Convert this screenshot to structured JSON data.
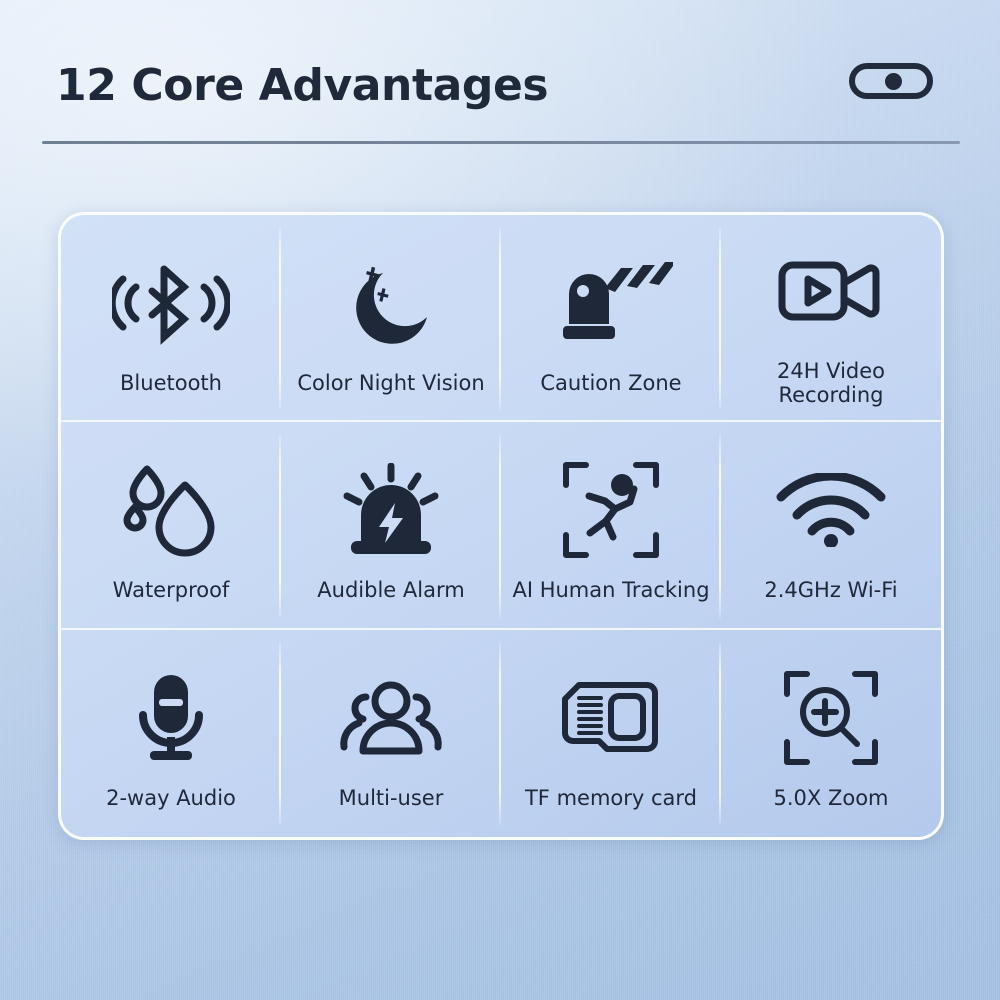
{
  "header": {
    "title": "12 Core Advantages",
    "toggle_name": "toggle-switch",
    "toggle_state": "on"
  },
  "colors": {
    "ink": "#20293a",
    "background_top": "#dde9f7",
    "background_bottom": "#a2bee2",
    "card_fill": "#cddcf4",
    "divider": "#ffffff",
    "rule": "#5b6a80"
  },
  "card": {
    "columns": 4,
    "rows": 3,
    "features": [
      {
        "label": "Bluetooth",
        "icon": "bluetooth-icon"
      },
      {
        "label": "Color Night Vision",
        "icon": "crescent-moon-stars-icon"
      },
      {
        "label": "Caution Zone",
        "icon": "boom-barrier-gate-icon"
      },
      {
        "label": "24H Video Recording",
        "icon": "video-camera-play-icon"
      },
      {
        "label": "Waterproof",
        "icon": "water-droplets-icon"
      },
      {
        "label": "Audible Alarm",
        "icon": "siren-lightning-icon"
      },
      {
        "label": "AI Human Tracking",
        "icon": "running-person-brackets-icon"
      },
      {
        "label": "2.4GHz Wi-Fi",
        "icon": "wifi-icon"
      },
      {
        "label": "2-way Audio",
        "icon": "microphone-icon"
      },
      {
        "label": "Multi-user",
        "icon": "people-group-icon"
      },
      {
        "label": "TF memory card",
        "icon": "memory-card-icon"
      },
      {
        "label": "5.0X Zoom",
        "icon": "magnifier-plus-brackets-icon"
      }
    ]
  }
}
